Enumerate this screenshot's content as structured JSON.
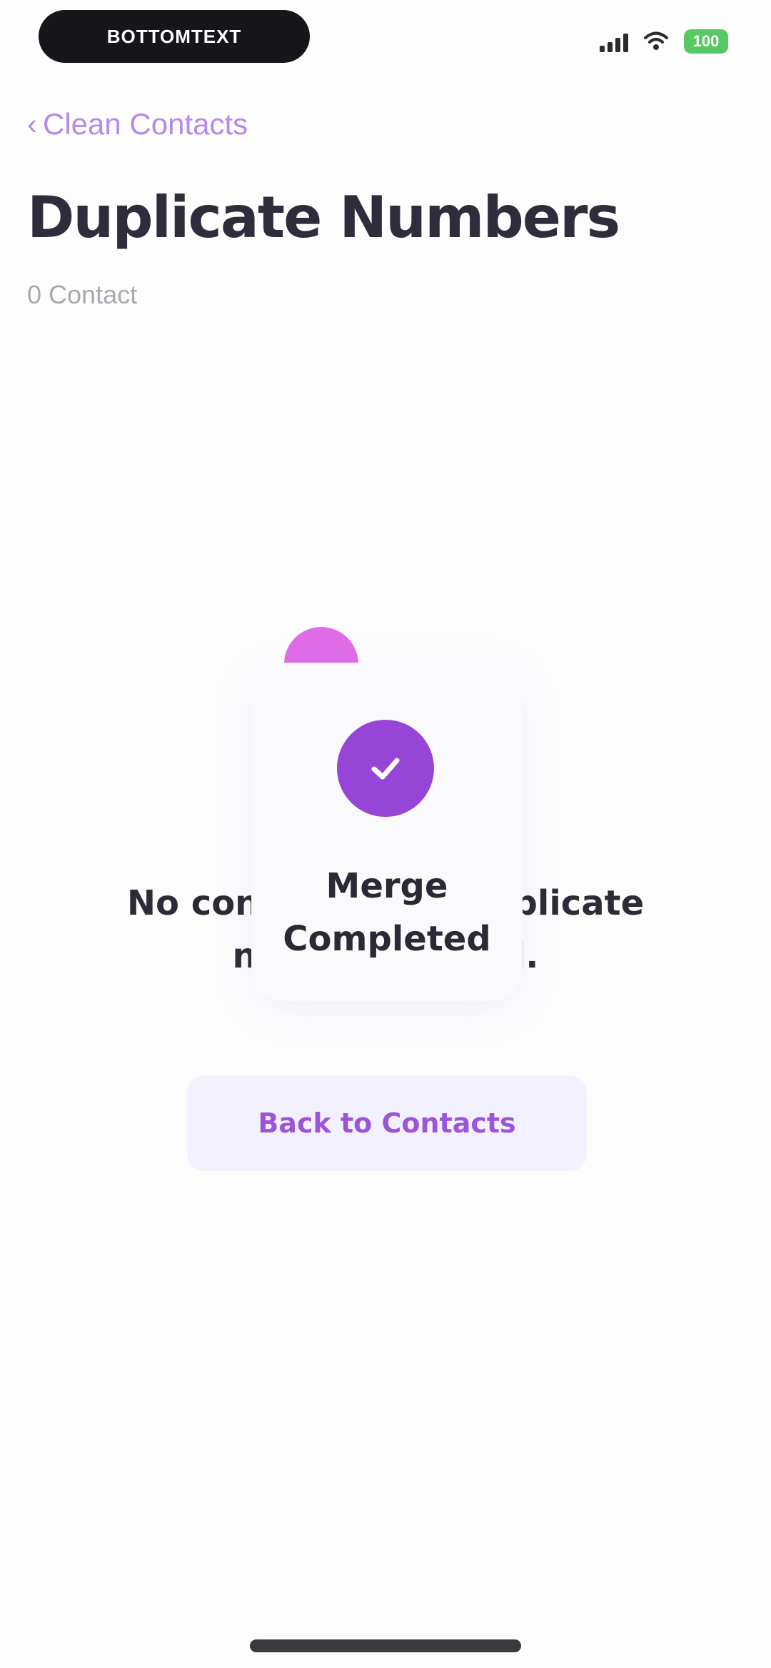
{
  "status_bar": {
    "app_pill_label": "BOTTOMTEXT",
    "battery_level": "100",
    "accent_battery": "#56c864"
  },
  "nav": {
    "back_label": "Clean Contacts",
    "back_chevron": "‹"
  },
  "header": {
    "title": "Duplicate Numbers",
    "subtitle": "0 Contact"
  },
  "empty_state": {
    "message": "No contacts with duplicate numbers found.",
    "button_label": "Back to Contacts"
  },
  "merge_popup": {
    "title": "Merge Completed",
    "icon": "checkmark-icon",
    "accent_color": "#9645d6"
  },
  "colors": {
    "accent": "#9c55d9",
    "link": "#b689ea",
    "button_bg": "#f3f1fd"
  }
}
